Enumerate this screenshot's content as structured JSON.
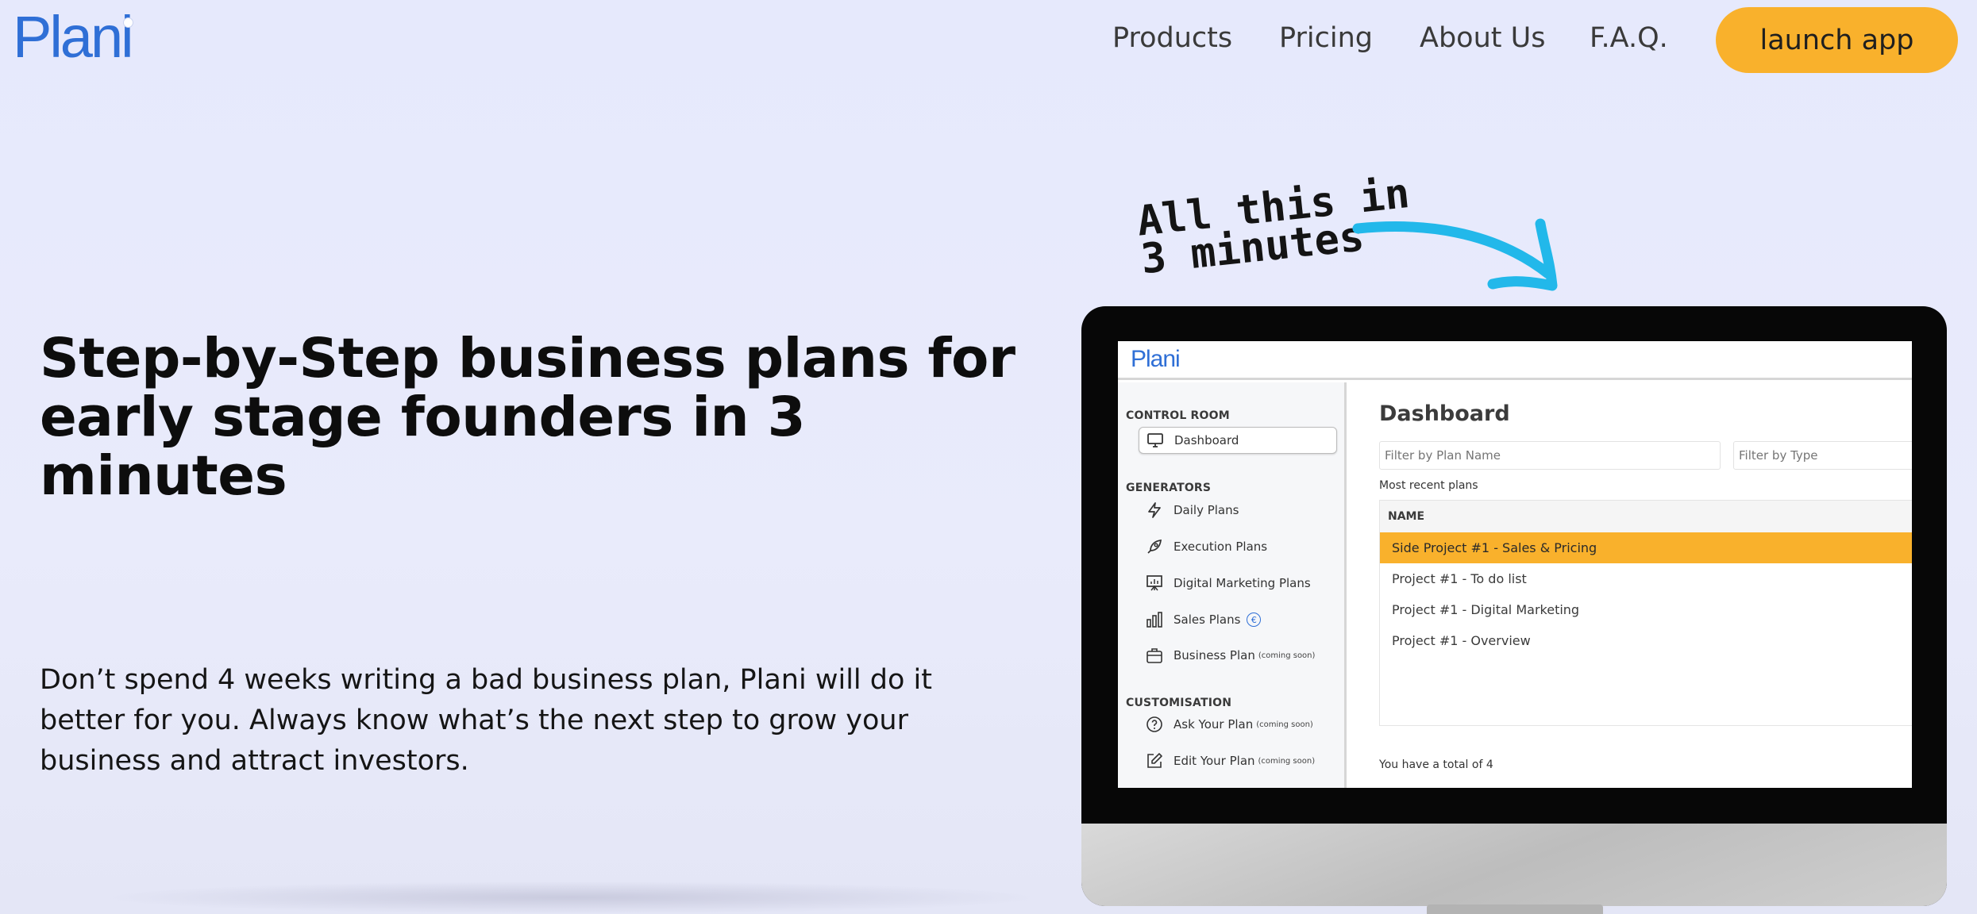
{
  "brand": {
    "logo": "Plani",
    "accent": "#2f6fd6",
    "cta_color": "#f9b12c"
  },
  "nav": {
    "items": [
      {
        "label": "Products"
      },
      {
        "label": "Pricing"
      },
      {
        "label": "About Us"
      },
      {
        "label": "F.A.Q."
      }
    ],
    "cta_label": "launch app"
  },
  "hero": {
    "title": "Step-by-Step business plans for early stage founders in 3 minutes",
    "subtitle": "Don’t spend 4 weeks writing a bad business plan, Plani will do it better for you. Always know what’s the next step to grow your business and attract investors."
  },
  "annotation": {
    "text": "All this in\n3 minutes"
  },
  "app_preview": {
    "logo": "Plani",
    "sidebar": {
      "sections": [
        {
          "label": "CONTROL ROOM"
        },
        {
          "label": "GENERATORS"
        },
        {
          "label": "CUSTOMISATION"
        }
      ],
      "items": [
        {
          "label": "Dashboard",
          "icon": "monitor-icon",
          "note": ""
        },
        {
          "label": "Daily Plans",
          "icon": "lightning-icon",
          "note": ""
        },
        {
          "label": "Execution Plans",
          "icon": "rocket-icon",
          "note": ""
        },
        {
          "label": "Digital Marketing Plans",
          "icon": "presentation-icon",
          "note": ""
        },
        {
          "label": "Sales Plans",
          "icon": "bar-chart-icon",
          "note": ""
        },
        {
          "label": "Business Plan",
          "icon": "briefcase-icon",
          "note": "(coming soon)"
        },
        {
          "label": "Ask Your Plan",
          "icon": "question-icon",
          "note": "(coming soon)"
        },
        {
          "label": "Edit Your Plan",
          "icon": "edit-icon",
          "note": "(coming soon)"
        }
      ],
      "sales_badge": "€"
    },
    "main": {
      "title": "Dashboard",
      "filter_name_placeholder": "Filter by Plan Name",
      "filter_type_placeholder": "Filter by Type",
      "recent_label": "Most recent plans",
      "table_header": "NAME",
      "rows": [
        {
          "name": "Side Project #1 - Sales & Pricing",
          "selected": true
        },
        {
          "name": "Project #1 - To do list",
          "selected": false
        },
        {
          "name": "Project #1 - Digital Marketing",
          "selected": false
        },
        {
          "name": "Project #1 - Overview",
          "selected": false
        }
      ],
      "total_text": "You have a total of 4"
    }
  }
}
